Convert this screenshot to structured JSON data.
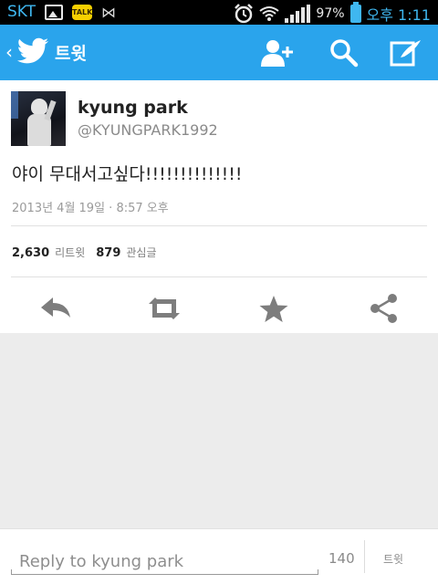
{
  "status_bar": {
    "carrier": "SKT",
    "battery": "97%",
    "time": "오후 1:11",
    "icons": [
      "image-icon",
      "kakaotalk-icon",
      "bowtie-icon",
      "alarm-icon",
      "wifi-icon",
      "signal-icon",
      "battery-icon"
    ],
    "talk_label": "TALK"
  },
  "header": {
    "title": "트윗",
    "icons": [
      "back-chevron-icon",
      "twitter-bird-icon",
      "add-user-icon",
      "search-icon",
      "compose-icon"
    ],
    "accent_color": "#2aa4ec"
  },
  "tweet": {
    "name": "kyung park",
    "handle": "@KYUNGPARK1992",
    "text": "야이 무대서고싶다!!!!!!!!!!!!!!",
    "timestamp": "2013년 4월 19일 · 8:57 오후",
    "retweet_count": "2,630",
    "retweet_label": "리트윗",
    "favorite_count": "879",
    "favorite_label": "관심글",
    "actions": [
      "reply-icon",
      "retweet-icon",
      "favorite-icon",
      "share-icon"
    ]
  },
  "reply": {
    "placeholder": "Reply to kyung park",
    "char_count": "140",
    "send_label": "트윗"
  }
}
